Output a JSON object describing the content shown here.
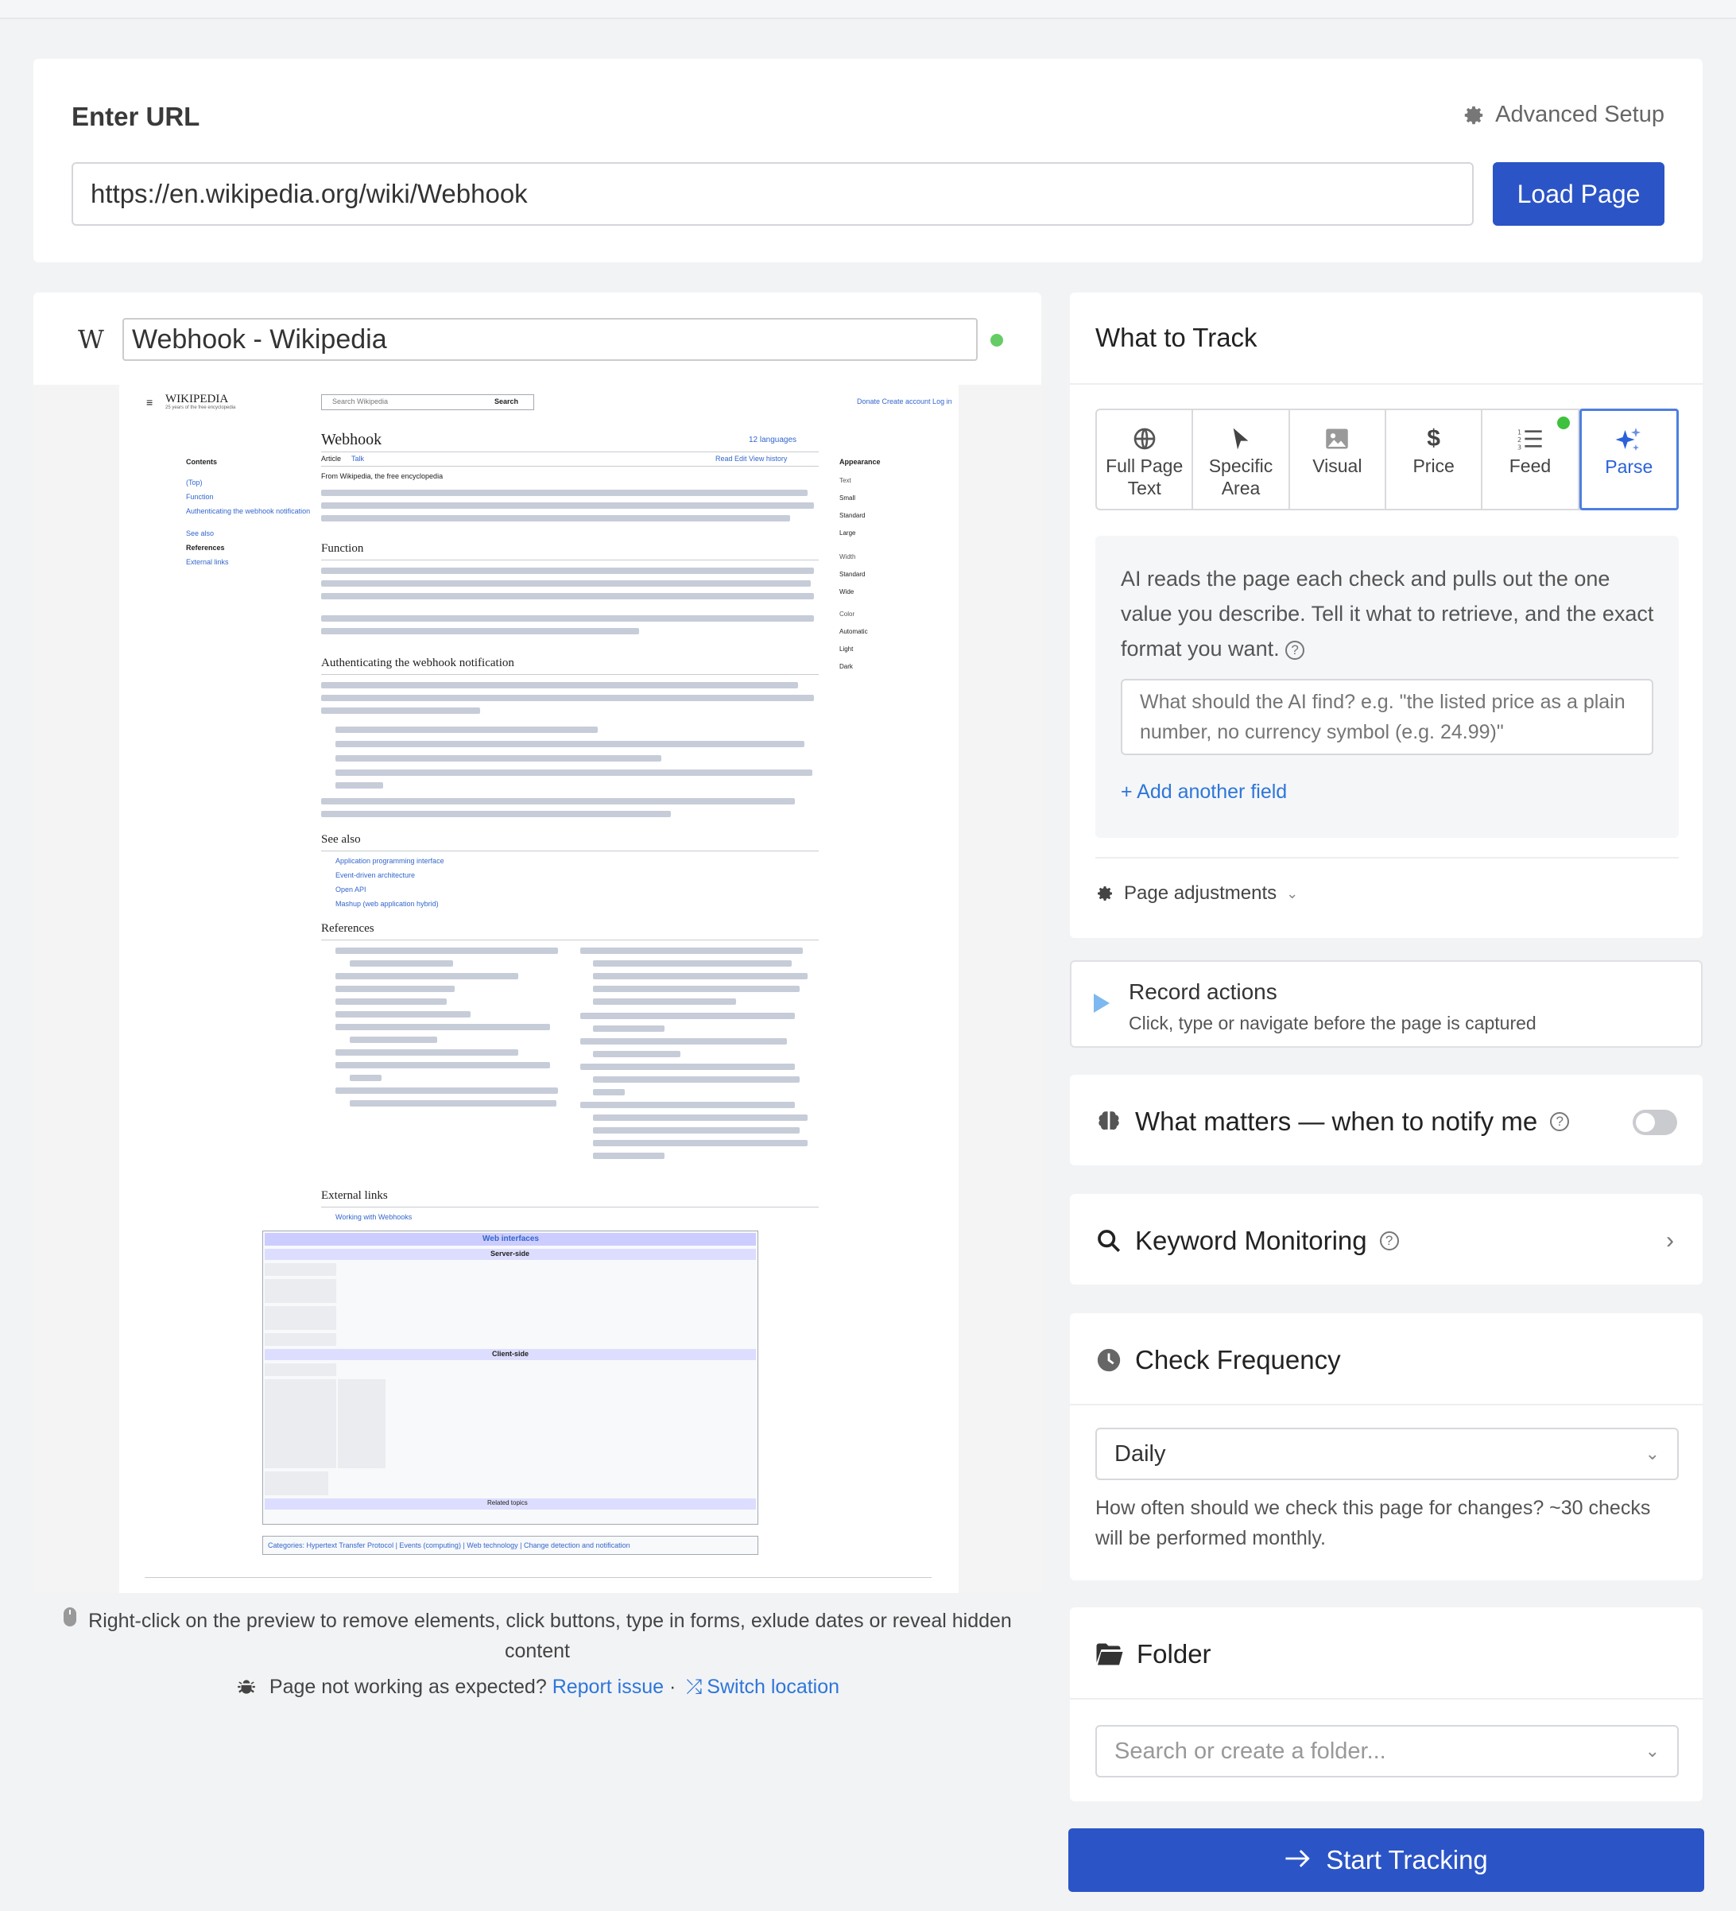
{
  "url_section": {
    "heading": "Enter URL",
    "advanced_label": "Advanced Setup",
    "url_value": "https://en.wikipedia.org/wiki/Webhook",
    "load_button": "Load Page"
  },
  "preview": {
    "page_title": "Webhook - Wikipedia",
    "site_icon": "W",
    "hint_text": "Right-click on the preview to remove elements, click buttons, type in forms, exlude dates or reveal hidden content",
    "issue_text": "Page not working as expected?",
    "report_link": "Report issue",
    "separator": "·",
    "switch_link": "Switch location",
    "wiki": {
      "logo": "WIKIPEDIA",
      "tagline": "25 years of the free encyclopedia",
      "search_placeholder": "Search Wikipedia",
      "search_button": "Search",
      "top_links": "Donate  Create account  Log in",
      "article_title": "Webhook",
      "languages": "12 languages",
      "tab_article": "Article",
      "tab_talk": "Talk",
      "tab_right": "Read   Edit   View history",
      "from": "From Wikipedia, the free encyclopedia",
      "contents_label": "Contents",
      "contents": [
        "(Top)",
        "Function",
        "Authenticating the webhook notification",
        "See also",
        "References",
        "External links"
      ],
      "appearance_label": "Appearance",
      "appearance": [
        "Text",
        "Small",
        "Standard",
        "Large",
        "Width",
        "Standard",
        "Wide",
        "Color",
        "Automatic",
        "Light",
        "Dark"
      ],
      "sections": [
        "Function",
        "Authenticating the webhook notification",
        "See also",
        "References",
        "External links"
      ],
      "see_also": [
        "Application programming interface",
        "Event-driven architecture",
        "Open API",
        "Mashup (web application hybrid)"
      ],
      "external": "Working with Webhooks",
      "navbox_title": "Web interfaces",
      "navbox_server": "Server-side",
      "navbox_client": "Client-side",
      "navbox_related": "Related topics",
      "categories": "Categories: Hypertext Transfer Protocol | Events (computing) | Web technology | Change detection and notification"
    }
  },
  "track": {
    "heading": "What to Track",
    "tabs": [
      {
        "label": "Full Page Text",
        "icon": "globe-icon"
      },
      {
        "label": "Specific Area",
        "icon": "cursor-icon"
      },
      {
        "label": "Visual",
        "icon": "image-icon"
      },
      {
        "label": "Price",
        "icon": "dollar-icon"
      },
      {
        "label": "Feed",
        "icon": "list-icon"
      },
      {
        "label": "Parse",
        "icon": "sparkle-icon"
      }
    ],
    "active_tab": "Parse",
    "parse_description": "AI reads the page each check and pulls out the one value you describe. Tell it what to retrieve, and the exact format you want.",
    "parse_placeholder": "What should the AI find? e.g. \"the listed price as a plain number, no currency symbol (e.g. 24.99)\"",
    "add_field": "+ Add another field",
    "page_adjustments": "Page adjustments"
  },
  "record": {
    "title": "Record actions",
    "subtitle": "Click, type or navigate before the page is captured"
  },
  "matters": {
    "title": "What matters — when to notify me",
    "enabled": false
  },
  "keyword": {
    "title": "Keyword Monitoring"
  },
  "frequency": {
    "title": "Check Frequency",
    "selected": "Daily",
    "help": "How often should we check this page for changes? ~30 checks will be performed monthly."
  },
  "folder": {
    "title": "Folder",
    "placeholder": "Search or create a folder..."
  },
  "start_button": "Start Tracking",
  "colors": {
    "primary": "#2b54c7",
    "link": "#2e76d9",
    "status_green": "#66cc66"
  }
}
